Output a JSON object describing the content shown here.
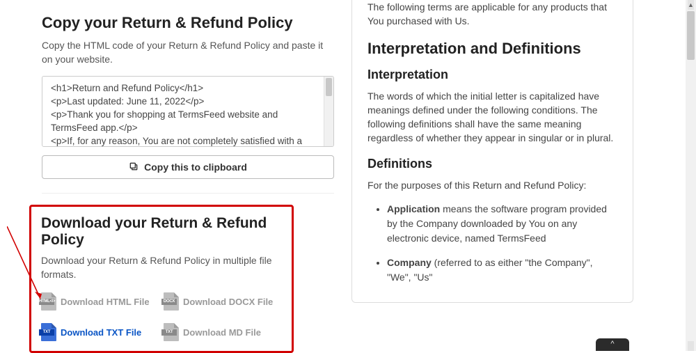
{
  "left": {
    "copy_section": {
      "title": "Copy your Return & Refund Policy",
      "subtitle": "Copy the HTML code of your Return & Refund Policy and paste it on your website.",
      "code_lines": [
        "<h1>Return and Refund Policy</h1>",
        "<p>Last updated: June 11, 2022</p>",
        "<p>Thank you for shopping at TermsFeed website and TermsFeed app.</p>",
        "<p>If, for any reason, You are not completely satisfied with a"
      ],
      "copy_button": "Copy this to clipboard"
    },
    "download_section": {
      "title": "Download your Return & Refund Policy",
      "subtitle": "Download your Return & Refund Policy in multiple file formats.",
      "items": [
        {
          "label": "Download HTML File",
          "band": "HTML</>",
          "active": false
        },
        {
          "label": "Download DOCX File",
          "band": "DOCX",
          "active": false
        },
        {
          "label": "Download TXT File",
          "band": "TXT",
          "active": true
        },
        {
          "label": "Download MD File",
          "band": "TXT",
          "active": false
        }
      ]
    }
  },
  "right": {
    "intro": "The following terms are applicable for any products that You purchased with Us.",
    "h2": "Interpretation and Definitions",
    "interp_h3": "Interpretation",
    "interp_body": "The words of which the initial letter is capitalized have meanings defined under the following conditions. The following definitions shall have the same meaning regardless of whether they appear in singular or in plural.",
    "defs_h3": "Definitions",
    "defs_intro": "For the purposes of this Return and Refund Policy:",
    "defs": [
      {
        "term": "Application",
        "rest": " means the software program provided by the Company downloaded by You on any electronic device, named TermsFeed"
      },
      {
        "term": "Company",
        "rest": " (referred to as either \"the Company\", \"We\", \"Us\""
      }
    ]
  },
  "colors": {
    "highlight_red": "#d10000",
    "link_blue": "#0a55c5"
  }
}
